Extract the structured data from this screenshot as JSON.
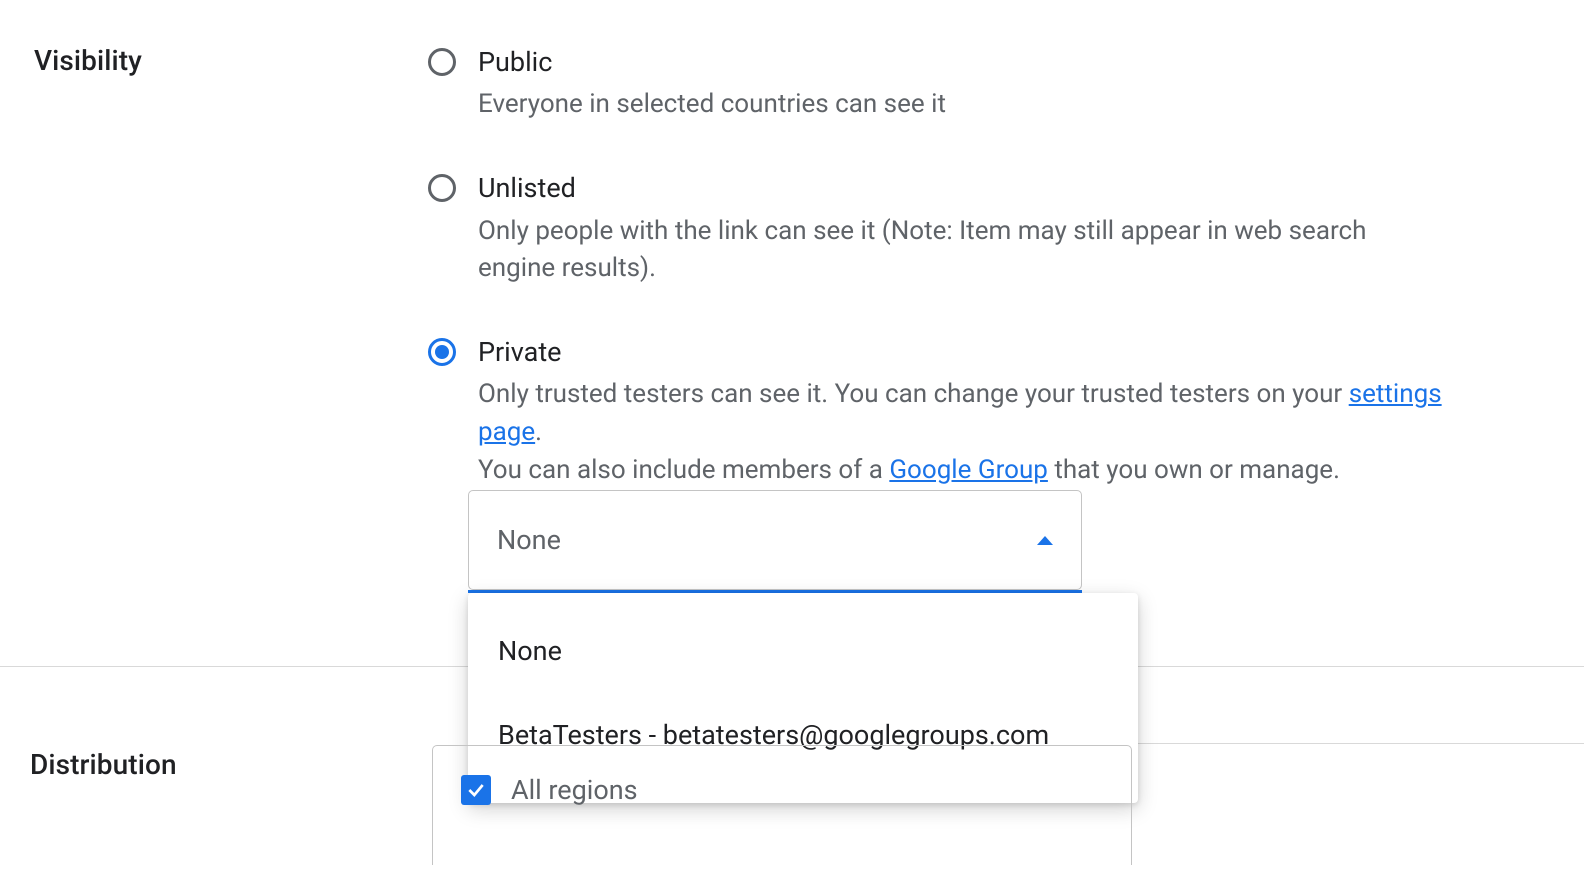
{
  "visibility": {
    "section_label": "Visibility",
    "options": [
      {
        "key": "public",
        "title": "Public",
        "description": "Everyone in selected countries can see it",
        "selected": false
      },
      {
        "key": "unlisted",
        "title": "Unlisted",
        "description": "Only people with the link can see it (Note: Item may still appear in web search engine results).",
        "selected": false
      },
      {
        "key": "private",
        "title": "Private",
        "desc_part1": "Only trusted testers can see it. You can change your trusted testers on your ",
        "settings_link_text": "settings page",
        "desc_part2": ".",
        "desc_part3": "You can also include members of a ",
        "group_link_text": "Google Group",
        "desc_part4": " that you own or manage.",
        "selected": true
      }
    ],
    "group_select": {
      "selected_value": "None",
      "options": [
        "None",
        "BetaTesters - betatesters@googlegroups.com"
      ]
    }
  },
  "distribution": {
    "section_label": "Distribution",
    "all_regions_label": "All regions",
    "all_regions_checked": true
  }
}
